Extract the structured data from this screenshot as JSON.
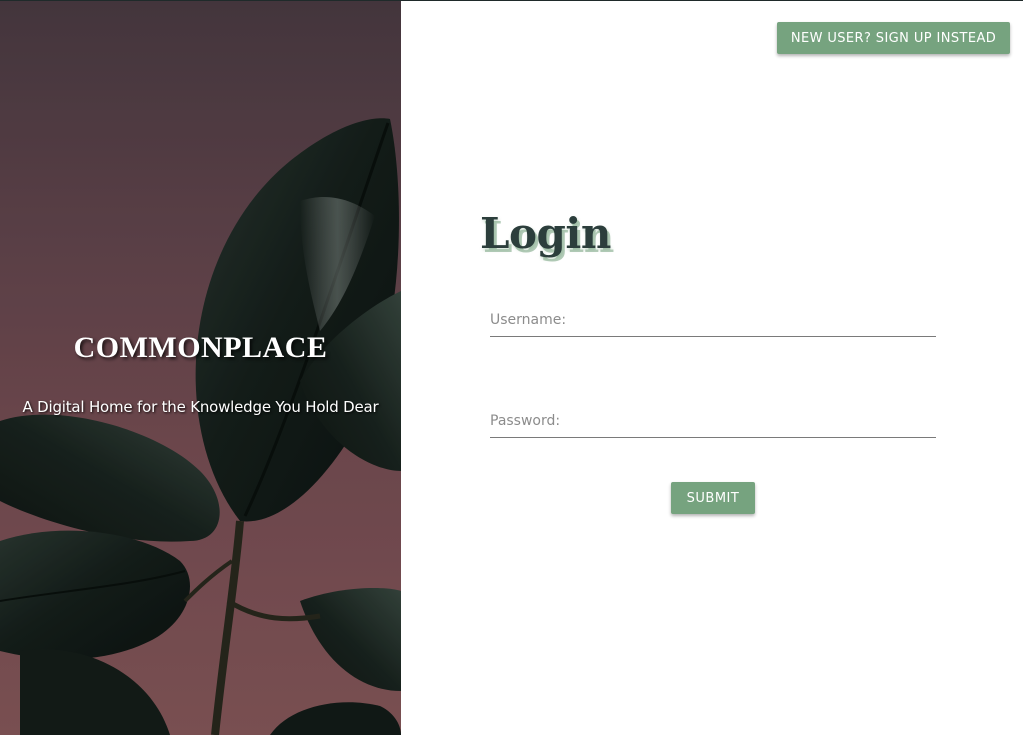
{
  "hero": {
    "brand_title": "COMMONPLACE",
    "tagline": "A Digital Home for the Knowledge You Hold Dear",
    "image": "rubber-plant-leaves"
  },
  "header": {
    "signup_label": "NEW USER? SIGN UP INSTEAD"
  },
  "login": {
    "title": "Login",
    "username_placeholder": "Username:",
    "username_value": "",
    "password_placeholder": "Password:",
    "password_value": "",
    "submit_label": "SUBMIT"
  },
  "colors": {
    "accent": "#76a37f",
    "title_text": "#2c3e3c",
    "hero_background": "#6e4c54"
  }
}
